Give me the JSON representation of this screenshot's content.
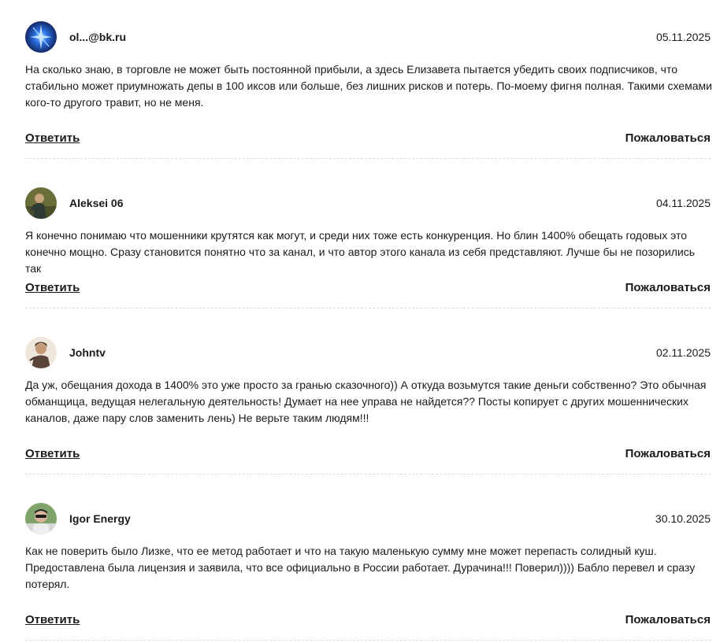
{
  "comments": [
    {
      "author": "ol...@bk.ru",
      "date": "05.11.2025",
      "text": "На сколько знаю, в торговле не может быть постоянной прибыли, а здесь Елизавета пытается убедить своих подписчиков, что стабильно может приумножать депы в 100 иксов или больше, без лишних рисков и потерь. По-моему фигня полная. Такими схемами кого-то другого травит, но не меня.",
      "reply_label": "Ответить",
      "report_label": "Пожаловаться"
    },
    {
      "author": "Aleksei 06",
      "date": "04.11.2025",
      "text": "Я конечно понимаю что мошенники крутятся как могут, и среди них тоже есть конкуренция. Но блин 1400% обещать годовых это конечно мощно. Сразу становится понятно что за канал, и что автор этого канала из себя представляют. Лучше бы не позорились так",
      "reply_label": "Ответить",
      "report_label": "Пожаловаться"
    },
    {
      "author": "Johntv",
      "date": "02.11.2025",
      "text": "Да уж, обещания дохода в 1400% это уже просто за гранью сказочного)) А откуда возьмутся такие деньги собственно? Это обычная обманщица, ведущая нелегальную деятельность! Думает на нее управа не найдется?? Посты копирует с других мошеннических каналов, даже пару слов заменить лень) Не верьте таким людям!!!",
      "reply_label": "Ответить",
      "report_label": "Пожаловаться"
    },
    {
      "author": "Igor Energy",
      "date": "30.10.2025",
      "text": "Как не поверить было Лизке, что ее метод работает и что на такую маленькую сумму мне может перепасть солидный куш. Предоставлена была лицензия и заявила, что все официально в России работает. Дурачина!!! Поверил)))) Бабло перевел и сразу потерял.",
      "reply_label": "Ответить",
      "report_label": "Пожаловаться"
    }
  ]
}
